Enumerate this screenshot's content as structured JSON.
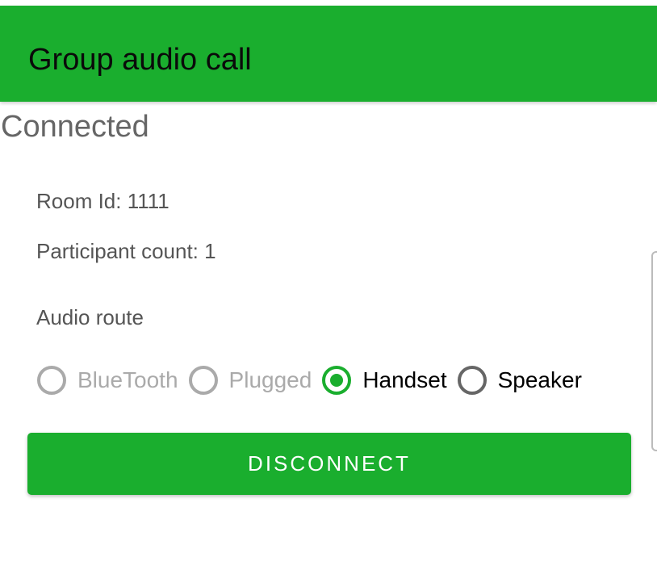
{
  "appbar": {
    "title": "Group audio call",
    "color": "#1aae2e"
  },
  "status": "Connected",
  "room_id": "Room Id: 1111",
  "participant_count": "Participant count: 1",
  "audio_route": {
    "label": "Audio route",
    "options": [
      {
        "label": "BlueTooth",
        "enabled": false,
        "checked": false
      },
      {
        "label": "Plugged",
        "enabled": false,
        "checked": false
      },
      {
        "label": "Handset",
        "enabled": true,
        "checked": true
      },
      {
        "label": "Speaker",
        "enabled": true,
        "checked": false
      }
    ]
  },
  "disconnect_label": "DISCONNECT"
}
